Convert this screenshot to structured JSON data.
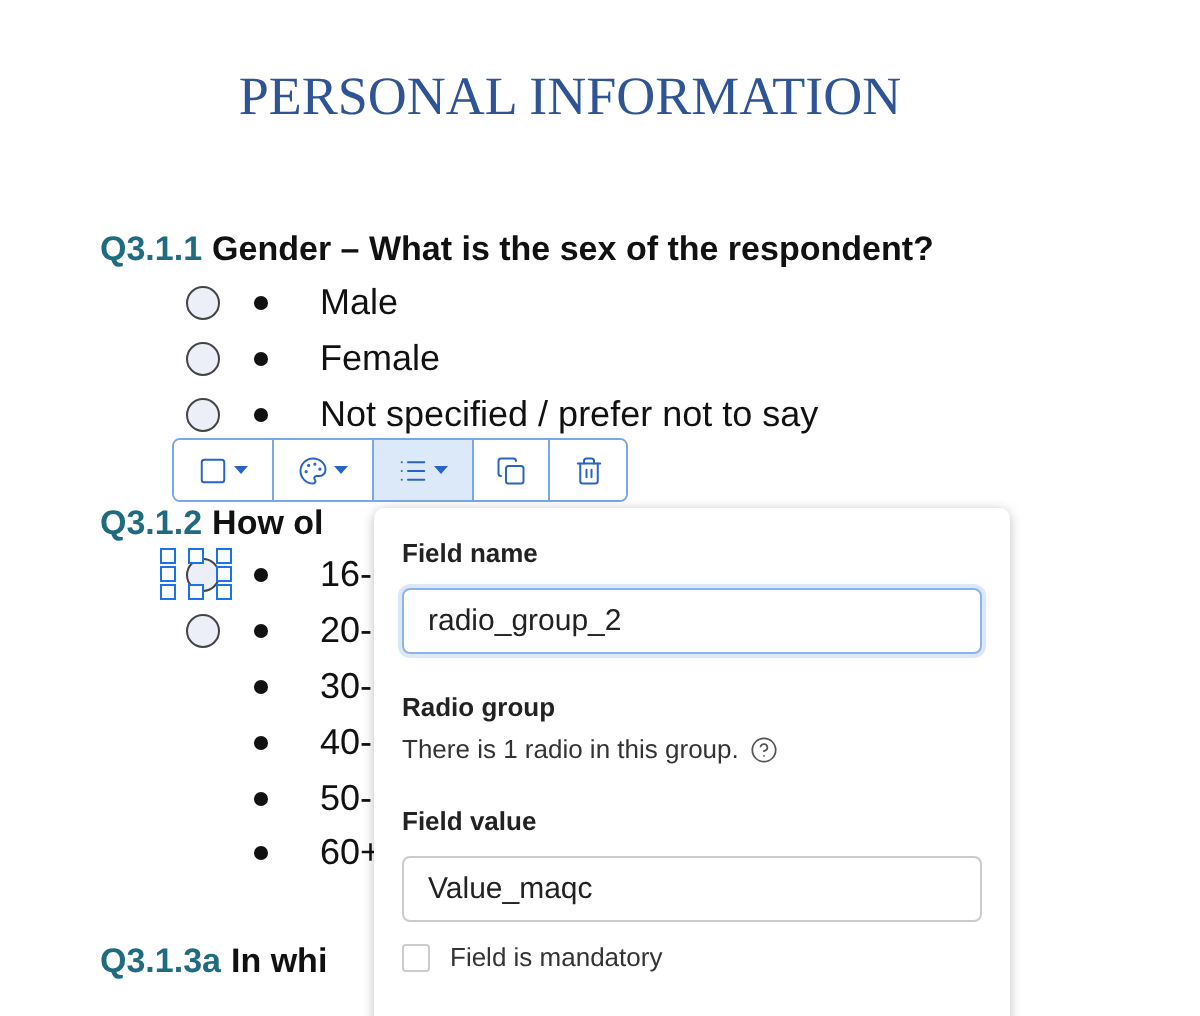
{
  "title": "PERSONAL INFORMATION",
  "questions": [
    {
      "number": "Q3.1.1",
      "text": "Gender – What is the sex of the respondent?",
      "options": [
        {
          "label": "Male",
          "radio": {
            "selected": false
          }
        },
        {
          "label": "Female",
          "radio": {
            "selected": false
          }
        },
        {
          "label": "Not specified / prefer not to say",
          "radio": {
            "selected": false
          }
        }
      ]
    },
    {
      "number": "Q3.1.2",
      "text": "How ol",
      "options": [
        {
          "label": "16-",
          "radio": {
            "selected": true
          }
        },
        {
          "label": "20-",
          "radio": {
            "selected": false
          }
        },
        {
          "label": "30-"
        },
        {
          "label": "40-"
        },
        {
          "label": "50-"
        },
        {
          "label": "60+"
        }
      ]
    },
    {
      "number": "Q3.1.3a",
      "text": "In whi"
    }
  ],
  "toolbar": [
    {
      "kind": "shape",
      "selected": false
    },
    {
      "kind": "color",
      "selected": false
    },
    {
      "kind": "properties",
      "selected": true
    },
    {
      "kind": "duplicate",
      "selected": false
    },
    {
      "kind": "delete",
      "selected": false
    }
  ],
  "popup": {
    "field_name_label": "Field name",
    "field_name": "radio_group_2",
    "group_heading": "Radio group",
    "group_info": "There is 1 radio in this group.",
    "field_value_label": "Field value",
    "field_value": "Value_maqc",
    "mandatory": {
      "label": "Field is mandatory",
      "checked": false
    }
  }
}
